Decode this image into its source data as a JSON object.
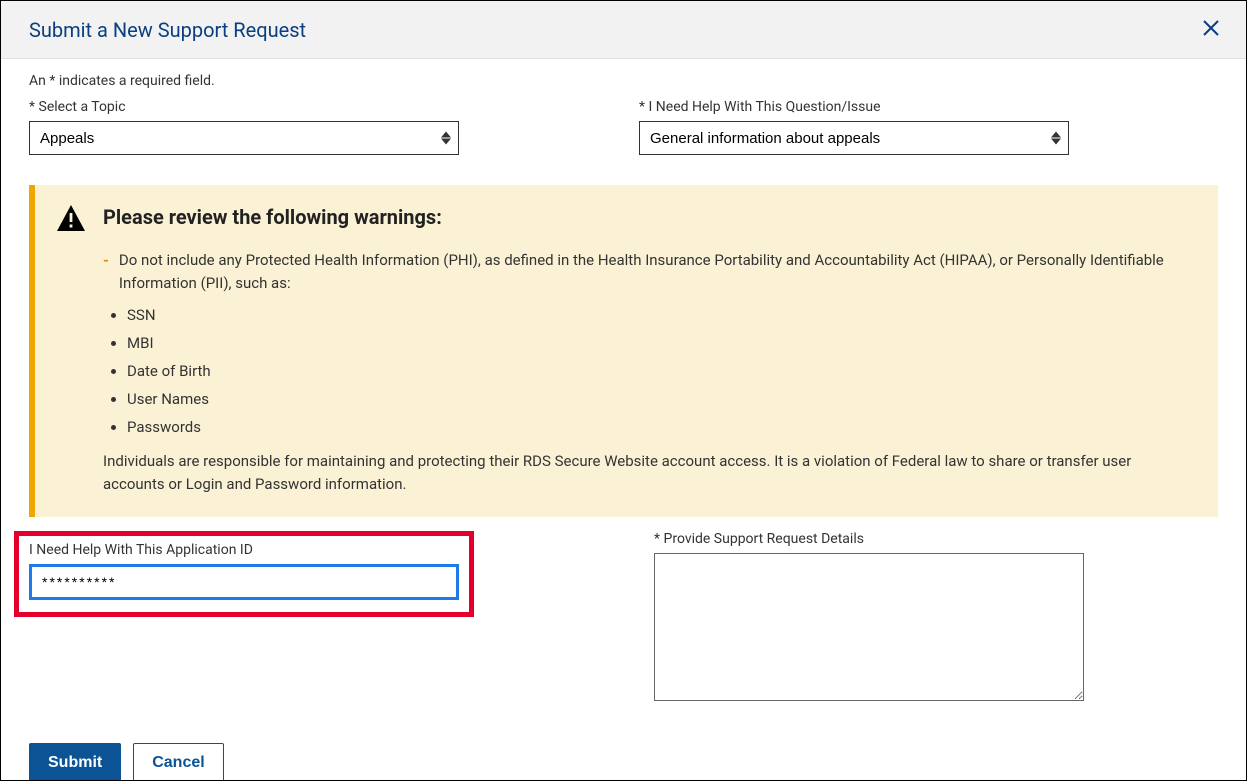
{
  "modal": {
    "title": "Submit a New Support Request"
  },
  "form": {
    "required_note": "An * indicates a required field.",
    "topic": {
      "label": "* Select a Topic",
      "value": "Appeals"
    },
    "issue": {
      "label": "* I Need Help With This Question/Issue",
      "value": "General information about appeals"
    },
    "application_id": {
      "label": "I Need Help With This Application ID",
      "value": "**********"
    },
    "details": {
      "label": "* Provide Support Request Details",
      "value": ""
    }
  },
  "warning": {
    "title": "Please review the following warnings:",
    "intro": "Do not include any Protected Health Information (PHI), as defined in the Health Insurance Portability and Accountability Act (HIPAA), or Personally Identifiable Information (PII), such as:",
    "items": [
      "SSN",
      "MBI",
      "Date of Birth",
      "User Names",
      "Passwords"
    ],
    "footer": "Individuals are responsible for maintaining and protecting their RDS Secure Website account access. It is a violation of Federal law to share or transfer user accounts or Login and Password information."
  },
  "actions": {
    "submit": "Submit",
    "cancel": "Cancel"
  }
}
